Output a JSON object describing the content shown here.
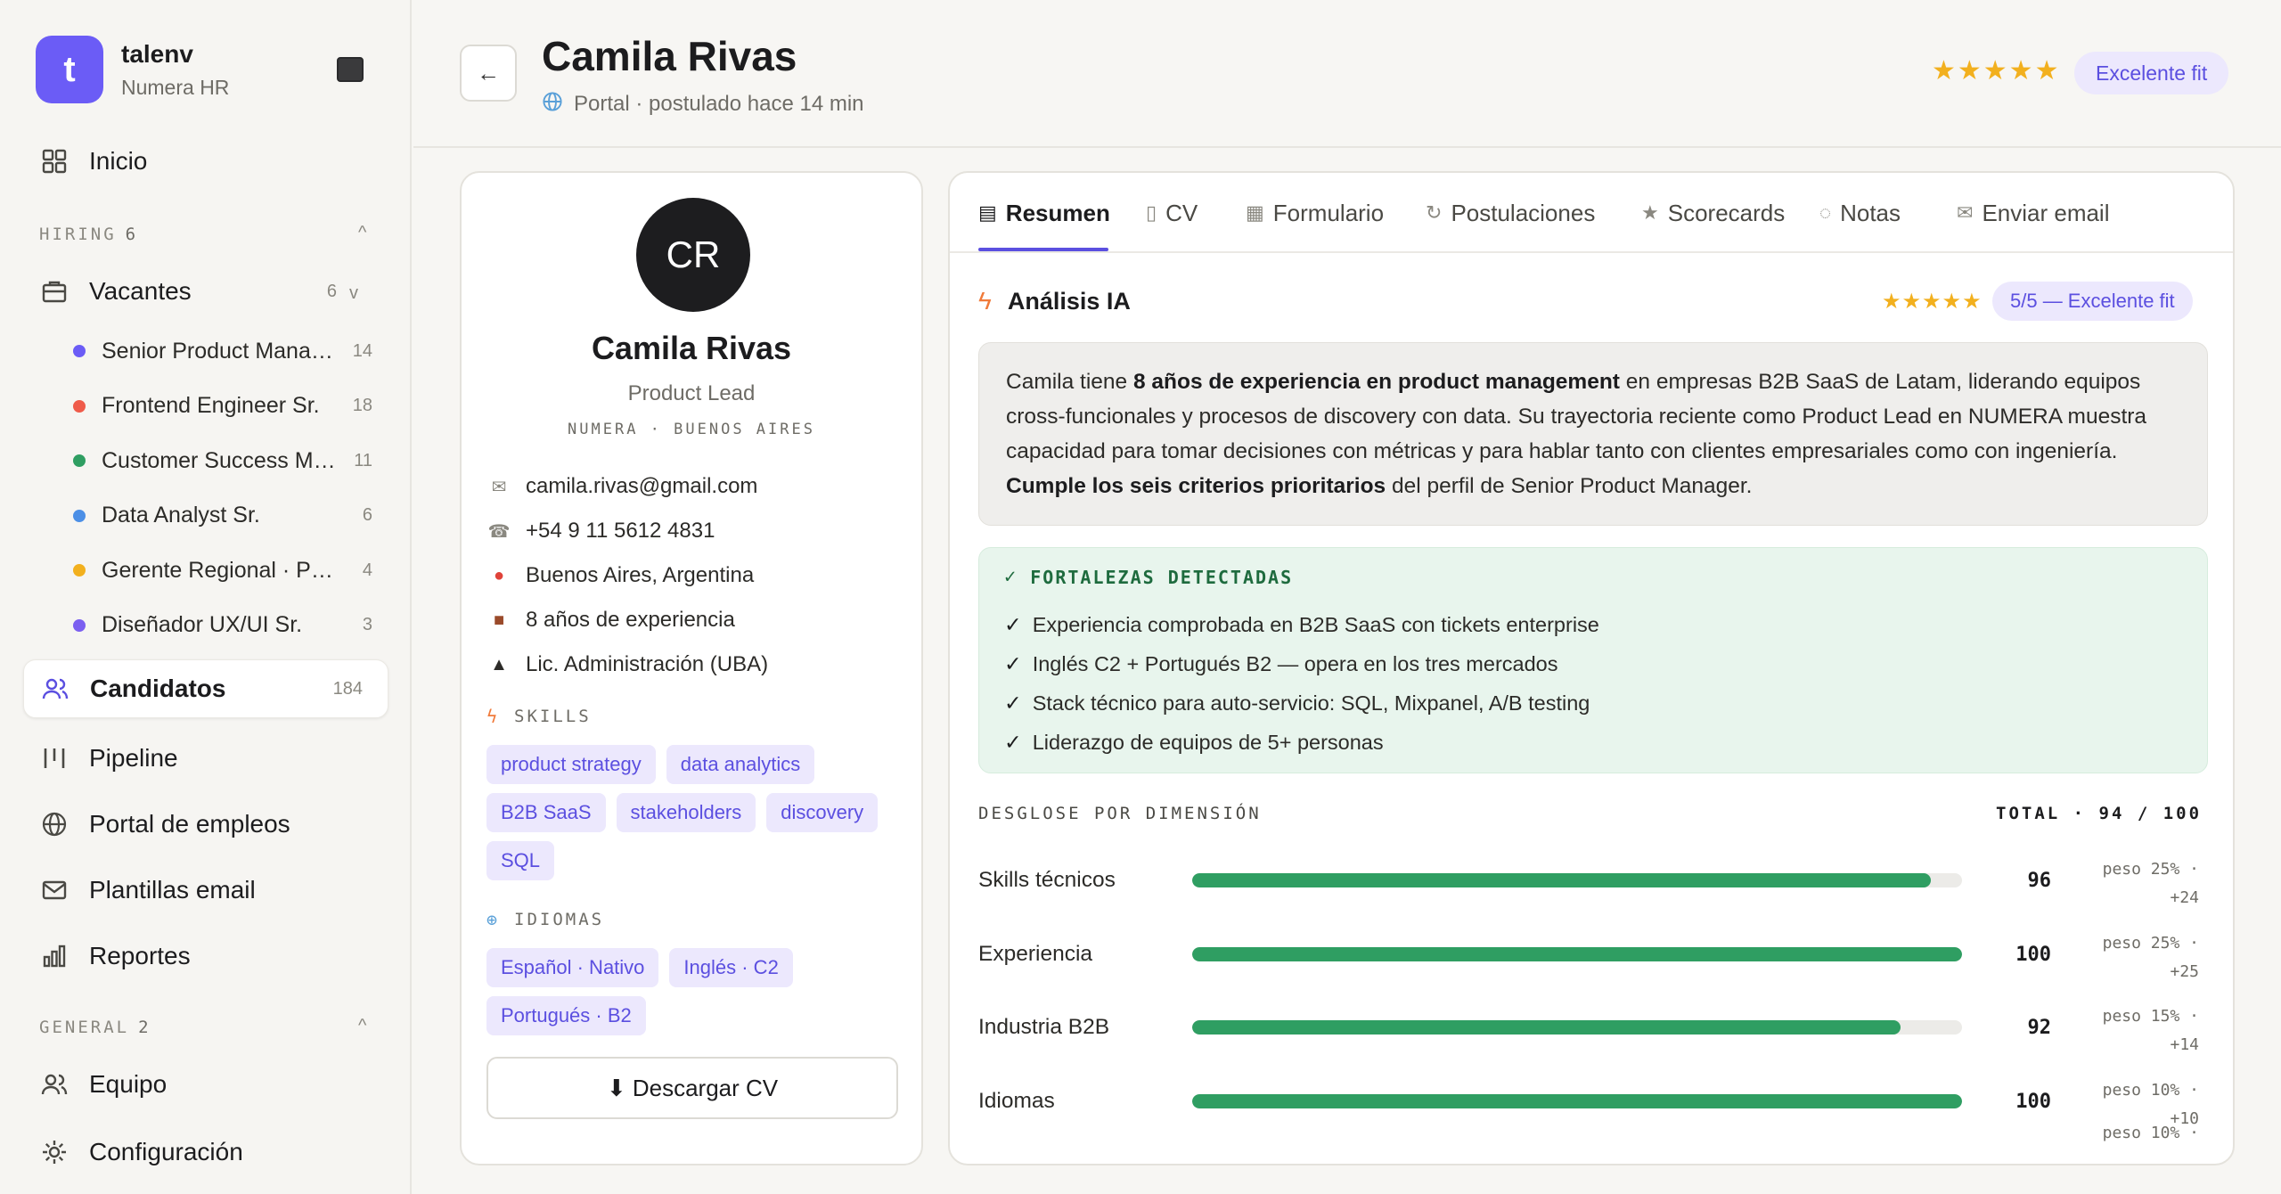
{
  "sidebar": {
    "brand_letter": "t",
    "brand_name": "talenv",
    "brand_sub": "Numera HR",
    "inicio": "Inicio",
    "hiring_label": "HIRING",
    "hiring_count": "6",
    "collapse_glyph": "^",
    "vacantes_label": "Vacantes",
    "vacantes_count": "6",
    "vacantes_caret": "v",
    "vacantes": [
      {
        "label": "Senior Product Manager",
        "count": "14",
        "color": "#6b5cf6"
      },
      {
        "label": "Frontend Engineer Sr.",
        "count": "18",
        "color": "#ef5b4a"
      },
      {
        "label": "Customer Success Mgr.",
        "count": "11",
        "color": "#2f9e62"
      },
      {
        "label": "Data Analyst Sr.",
        "count": "6",
        "color": "#4c8fe6"
      },
      {
        "label": "Gerente Regional · Presales",
        "count": "4",
        "color": "#f2b01e"
      },
      {
        "label": "Diseñador UX/UI Sr.",
        "count": "3",
        "color": "#7b5ff0"
      }
    ],
    "candidatos_label": "Candidatos",
    "candidatos_count": "184",
    "pipeline": "Pipeline",
    "portal": "Portal de empleos",
    "plantillas": "Plantillas email",
    "reportes": "Reportes",
    "general_label": "GENERAL",
    "general_count": "2",
    "equipo": "Equipo",
    "configuracion": "Configuración"
  },
  "header": {
    "back_glyph": "←",
    "name": "Camila Rivas",
    "source": "Portal · postulado hace 14 min",
    "stars": "★★★★★",
    "fit_badge": "Excelente fit"
  },
  "profile": {
    "initials": "CR",
    "name": "Camila Rivas",
    "role": "Product Lead",
    "org": "NUMERA · BUENOS AIRES",
    "email": "camila.rivas@gmail.com",
    "phone": "+54 9 11 5612 4831",
    "location": "Buenos Aires, Argentina",
    "experience": "8 años de experiencia",
    "education": "Lic. Administración (UBA)",
    "skills_label": "SKILLS",
    "skills": [
      "product strategy",
      "data analytics",
      "B2B SaaS",
      "stakeholders",
      "discovery",
      "SQL"
    ],
    "languages_label": "IDIOMAS",
    "languages": [
      "Español · Nativo",
      "Inglés · C2",
      "Portugués · B2"
    ],
    "download_label": "⬇ Descargar CV"
  },
  "tabs": [
    {
      "icon": "▤",
      "label": "Resumen",
      "name": "tab-resumen"
    },
    {
      "icon": "▯",
      "label": "CV",
      "name": "tab-cv"
    },
    {
      "icon": "▦",
      "label": "Formulario",
      "name": "tab-formulario"
    },
    {
      "icon": "↻",
      "label": "Postulaciones",
      "name": "tab-postulaciones"
    },
    {
      "icon": "★",
      "label": "Scorecards",
      "name": "tab-scorecards"
    },
    {
      "icon": "◌",
      "label": "Notas",
      "name": "tab-notas"
    },
    {
      "icon": "✉",
      "label": "Enviar email",
      "name": "tab-enviar-email"
    }
  ],
  "ai": {
    "title": "Análisis IA",
    "stars": "★★★★★",
    "badge": "5/5 — Excelente fit",
    "summary_p1": "Camila tiene ",
    "summary_b1": "8 años de experiencia en product management",
    "summary_p2": " en empresas B2B SaaS de Latam, liderando equipos cross-funcionales y procesos de discovery con data. Su trayectoria reciente como Product Lead en NUMERA muestra capacidad para tomar decisiones con métricas y para hablar tanto con clientes empresariales como con ingeniería. ",
    "summary_b2": "Cumple los seis criterios prioritarios",
    "summary_p3": " del perfil de Senior Product Manager."
  },
  "strengths": {
    "title": "FORTALEZAS DETECTADAS",
    "items": [
      "Experiencia comprobada en B2B SaaS con tickets enterprise",
      "Inglés C2 + Portugués B2 — opera en los tres mercados",
      "Stack técnico para auto-servicio: SQL, Mixpanel, A/B testing",
      "Liderazgo de equipos de 5+ personas"
    ]
  },
  "dimensions": {
    "title": "DESGLOSE POR DIMENSIÓN",
    "total": "TOTAL · 94 / 100",
    "rows": [
      {
        "label": "Skills técnicos",
        "score": 96,
        "weight": "peso 25% ·",
        "points": "+24"
      },
      {
        "label": "Experiencia",
        "score": 100,
        "weight": "peso 25% ·",
        "points": "+25"
      },
      {
        "label": "Industria B2B",
        "score": 92,
        "weight": "peso 15% ·",
        "points": "+14"
      },
      {
        "label": "Idiomas",
        "score": 100,
        "weight": "peso 10% ·",
        "points": "+10"
      }
    ],
    "partial_weight": "peso 10% ·"
  }
}
